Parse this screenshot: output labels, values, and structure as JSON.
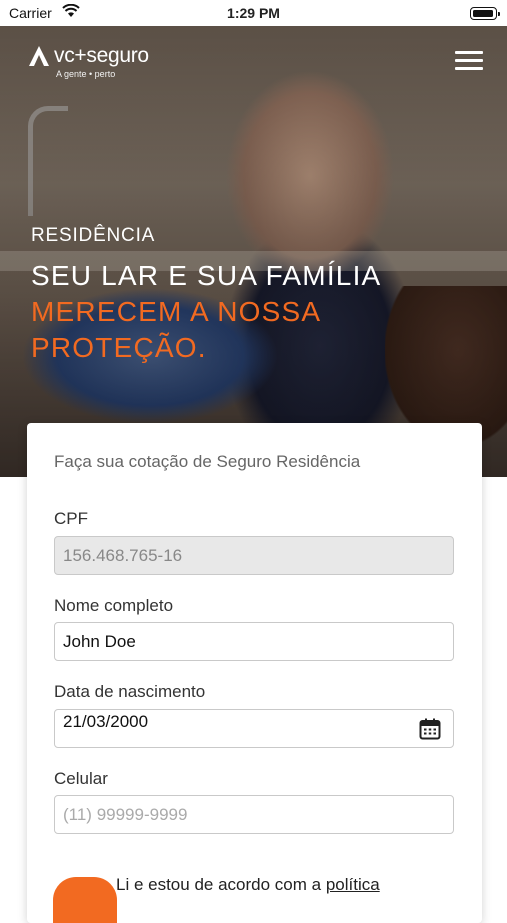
{
  "status_bar": {
    "carrier": "Carrier",
    "time": "1:29 PM"
  },
  "header": {
    "logo_text": "vc+seguro",
    "logo_tagline": "A gente • perto"
  },
  "hero": {
    "kicker": "RESIDÊNCIA",
    "headline_white": "SEU LAR E SUA FAMÍLIA",
    "headline_orange_1": "MERECEM A NOSSA",
    "headline_orange_2": "PROTEÇÃO."
  },
  "form": {
    "intro": "Faça sua cotação de Seguro Residência",
    "cpf": {
      "label": "CPF",
      "value": "156.468.765-16"
    },
    "name": {
      "label": "Nome completo",
      "value": "John Doe"
    },
    "birth": {
      "label": "Data de nascimento",
      "value": "21/03/2000"
    },
    "phone": {
      "label": "Celular",
      "value": "",
      "placeholder": "(11) 99999-9999"
    },
    "agree_text": "Li e estou de acordo com a",
    "agree_link": "política"
  },
  "colors": {
    "accent": "#f26a21",
    "field_border": "#c9c9c9",
    "disabled_bg": "#e8e8e8"
  }
}
